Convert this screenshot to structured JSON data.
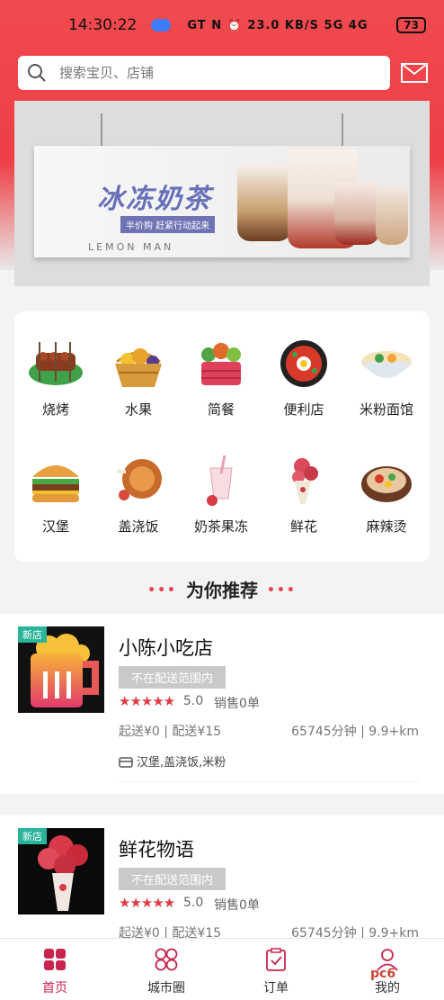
{
  "status_bar": {
    "time": "14:30:22",
    "indicators": "GT N ⏰ 23.0 KB/S 5G 4G",
    "battery": "73"
  },
  "search": {
    "placeholder": "搜索宝贝、店铺",
    "icon": "search-icon"
  },
  "header": {
    "message_icon": "mail-icon"
  },
  "banner": {
    "title": "冰冻奶茶",
    "tagline": "半价购  赶紧行动起来",
    "subtitle": "LEMON MAN"
  },
  "categories": [
    {
      "label": "烧烤",
      "icon": "bbq-icon"
    },
    {
      "label": "水果",
      "icon": "fruit-basket-icon"
    },
    {
      "label": "简餐",
      "icon": "vegetable-basket-icon"
    },
    {
      "label": "便利店",
      "icon": "hotpot-icon"
    },
    {
      "label": "米粉面馆",
      "icon": "noodle-bowl-icon"
    },
    {
      "label": "汉堡",
      "icon": "burger-icon"
    },
    {
      "label": "盖浇饭",
      "icon": "rice-plate-icon"
    },
    {
      "label": "奶茶果冻",
      "icon": "milk-tea-icon"
    },
    {
      "label": "鲜花",
      "icon": "flower-bouquet-icon"
    },
    {
      "label": "麻辣烫",
      "icon": "spicy-pot-icon"
    }
  ],
  "recommend": {
    "title": "为你推荐",
    "dots": "•••"
  },
  "shops": [
    {
      "badge": "新店",
      "name": "小陈小吃店",
      "status": "不在配送范围内",
      "stars": "★★★★★",
      "rating": "5.0",
      "sales": "销售0单",
      "fee": "起送¥0 | 配送¥15",
      "distance": "65745分钟 | 9.9+km",
      "categories": "汉堡,盖浇饭,米粉"
    },
    {
      "badge": "新店",
      "name": "鲜花物语",
      "status": "不在配送范围内",
      "stars": "★★★★★",
      "rating": "5.0",
      "sales": "销售0单",
      "fee": "起送¥0 | 配送¥15",
      "distance": "65745分钟 | 9.9+km"
    }
  ],
  "tabs": [
    {
      "label": "首页",
      "icon": "home-grid-icon"
    },
    {
      "label": "城市圈",
      "icon": "city-circle-icon"
    },
    {
      "label": "订单",
      "icon": "order-clipboard-icon"
    },
    {
      "label": "我的",
      "icon": "user-profile-icon"
    }
  ],
  "watermark": "pc6",
  "colors": {
    "accent": "#ee3f45",
    "tab_active": "#c8244d",
    "badge": "#2ab49a"
  }
}
